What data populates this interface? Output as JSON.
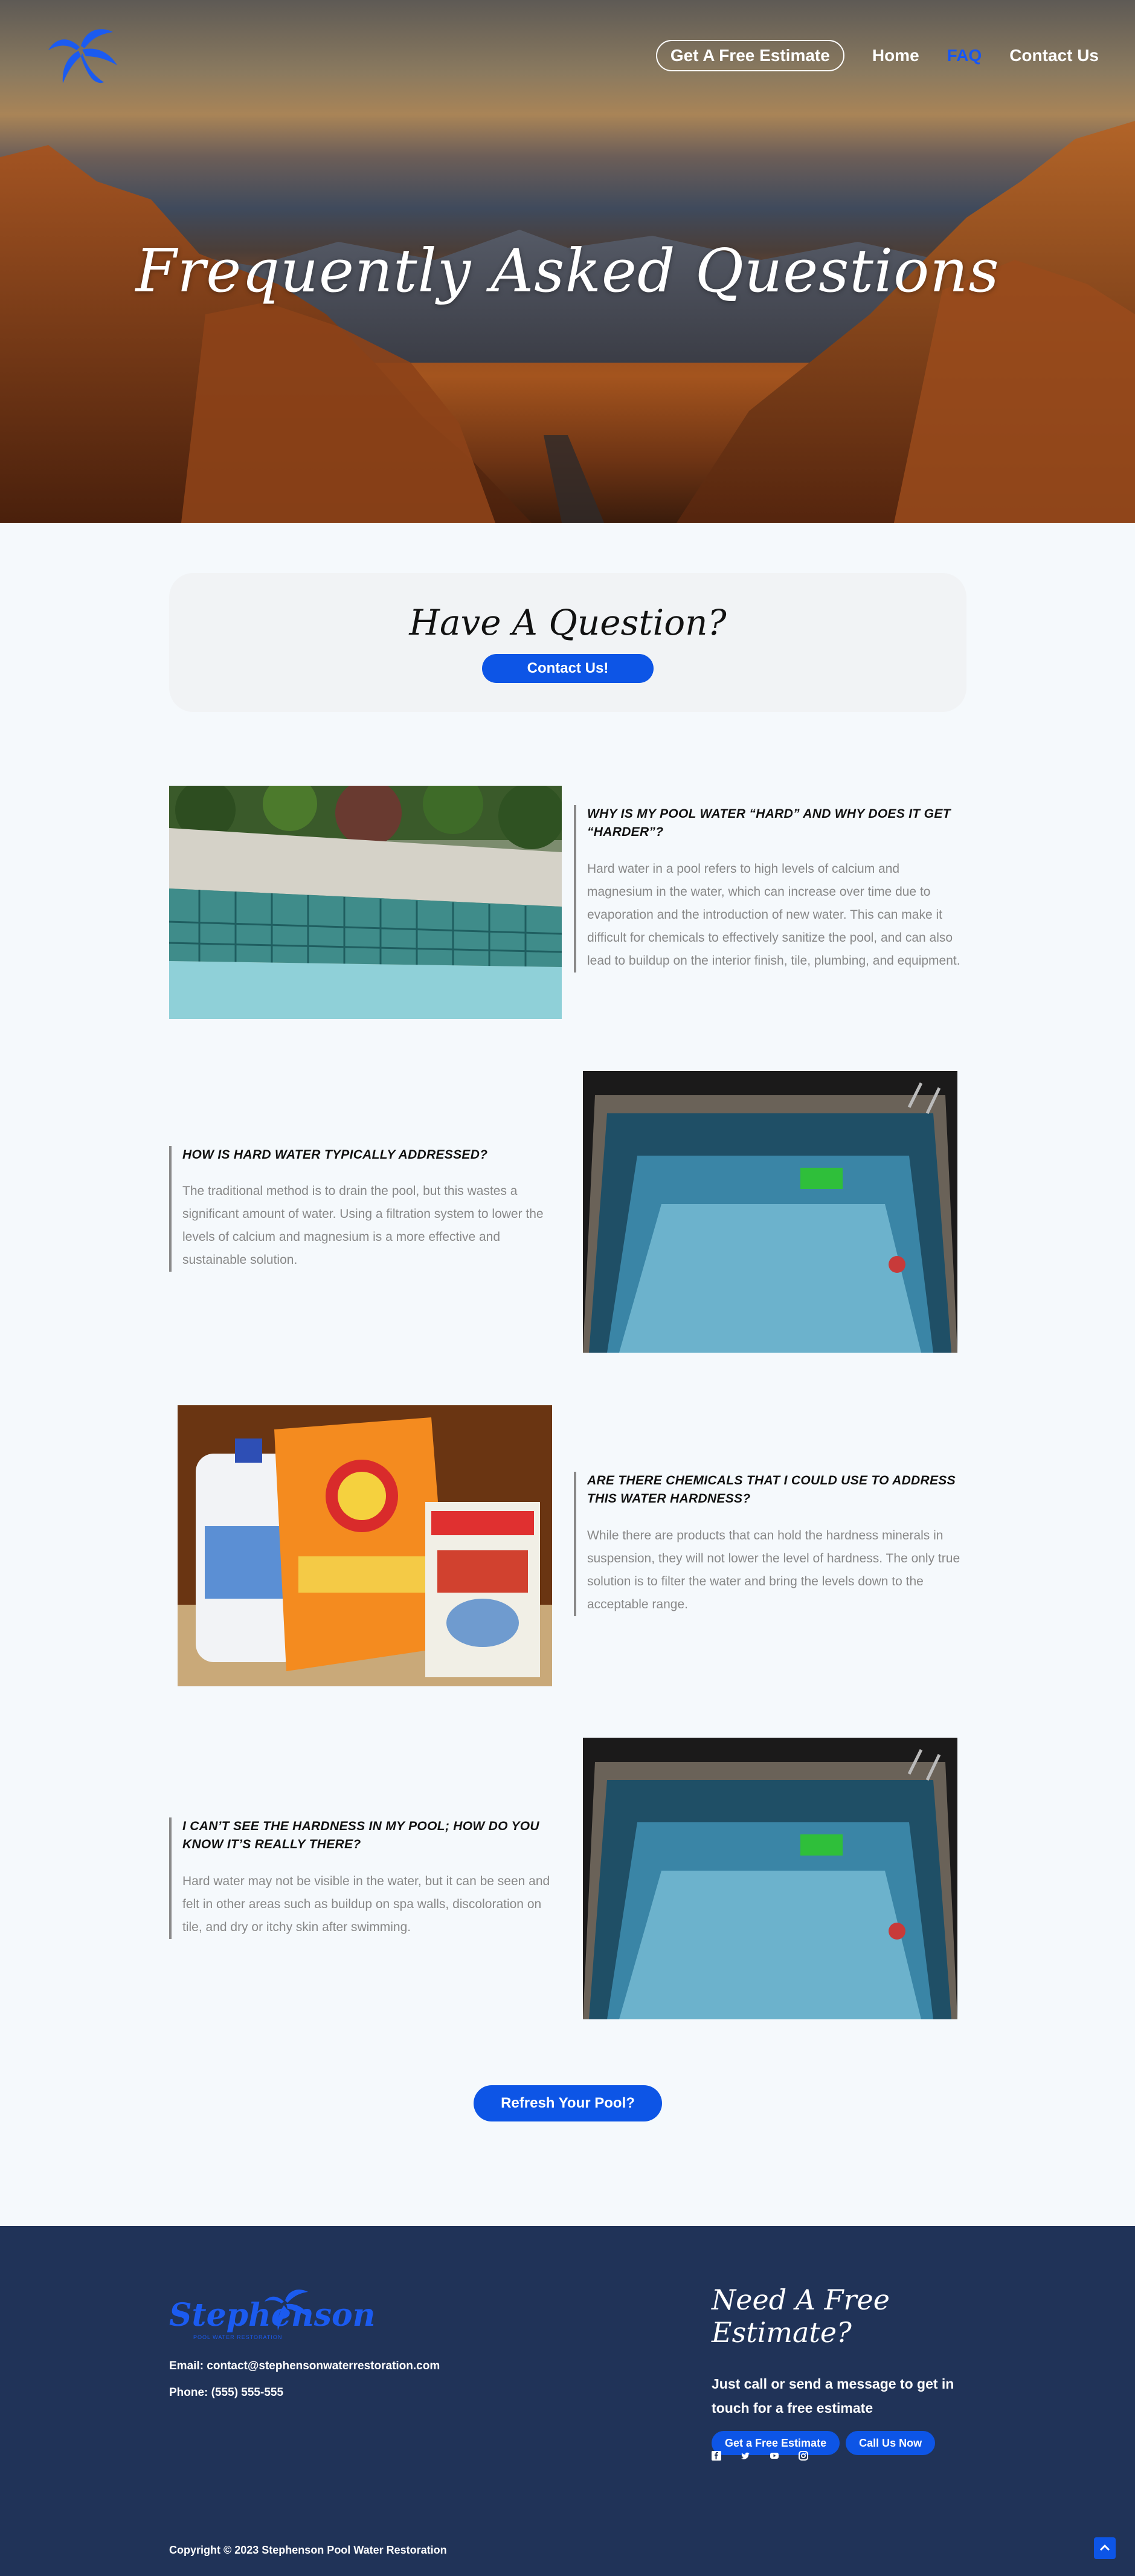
{
  "header": {
    "nav": {
      "estimate_label": "Get A Free Estimate",
      "home_label": "Home",
      "faq_label": "FAQ",
      "contact_label": "Contact Us"
    },
    "hero_title": "Frequently Asked Questions"
  },
  "question_box": {
    "title": "Have A Question?",
    "button_label": "Contact Us!"
  },
  "faqs": [
    {
      "question": "Why is my pool water “hard” and why does it get “harder”?",
      "answer": "Hard water in a pool refers to high levels of calcium and magnesium in the water, which can increase over time due to evaporation and the introduction of new water. This can make it difficult for chemicals to effectively sanitize the pool, and can also lead to buildup on the interior finish, tile, plumbing, and equipment."
    },
    {
      "question": "How is hard water typically addressed?",
      "answer": "The traditional method is to drain the pool, but this wastes a significant amount of water. Using a filtration system to lower the levels of calcium and magnesium is a more effective and sustainable solution."
    },
    {
      "question": "Are there chemicals that I could use to address this water hardness?",
      "answer": "While there are products that can hold the hardness minerals in suspension, they will not lower the level of hardness. The only true solution is to filter the water and bring the levels down to the acceptable range."
    },
    {
      "question": "I can’t see the hardness in my pool; how do you know it’s really there?",
      "answer": "Hard water may not be visible in the water, but it can be seen and felt in other areas such as buildup on spa walls, discoloration on tile, and dry or itchy skin after swimming."
    }
  ],
  "refresh_button_label": "Refresh Your Pool?",
  "footer": {
    "logo_text": "Stephenson",
    "logo_subtext": "POOL WATER RESTORATION",
    "email": "Email: contact@stephensonwaterrestoration.com",
    "phone": "Phone: (555) 555-555",
    "cta_title": "Need A Free Estimate?",
    "cta_text": "Just call or send a message to get in touch for a free estimate",
    "estimate_button_label": "Get a Free Estimate",
    "call_button_label": "Call Us Now",
    "socials": [
      "facebook-icon",
      "twitter-icon",
      "youtube-icon",
      "instagram-icon"
    ],
    "copyright": "Copyright © 2023 Stephenson Pool Water Restoration"
  },
  "colors": {
    "accent": "#0d55e6",
    "footer_bg": "#203358",
    "page_bg": "#f5f9fc",
    "active_nav": "#1656f5"
  }
}
